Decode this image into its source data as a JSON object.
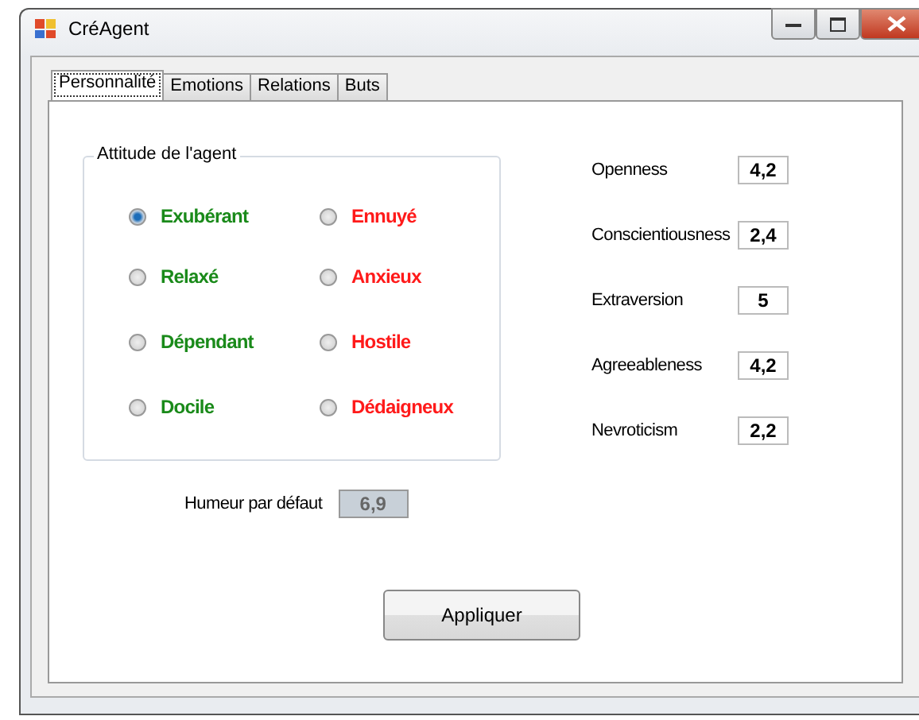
{
  "window": {
    "title": "CréAgent"
  },
  "tabs": [
    {
      "label": "Personnalité",
      "selected": true
    },
    {
      "label": "Emotions",
      "selected": false
    },
    {
      "label": "Relations",
      "selected": false
    },
    {
      "label": "Buts",
      "selected": false
    }
  ],
  "attitude_group": {
    "title": "Attitude de l'agent",
    "options": [
      {
        "label": "Exubérant",
        "selected": true,
        "color": "#1a8a1a"
      },
      {
        "label": "Ennuyé",
        "selected": false,
        "color": "#ff1a1a"
      },
      {
        "label": "Relaxé",
        "selected": false,
        "color": "#1a8a1a"
      },
      {
        "label": "Anxieux",
        "selected": false,
        "color": "#ff1a1a"
      },
      {
        "label": "Dépendant",
        "selected": false,
        "color": "#1a8a1a"
      },
      {
        "label": "Hostile",
        "selected": false,
        "color": "#ff1a1a"
      },
      {
        "label": "Docile",
        "selected": false,
        "color": "#1a8a1a"
      },
      {
        "label": "Dédaigneux",
        "selected": false,
        "color": "#ff1a1a"
      }
    ]
  },
  "default_mood": {
    "label": "Humeur par défaut",
    "value": "6,9",
    "disabled": true
  },
  "apply_button": "Appliquer",
  "traits": [
    {
      "label": "Openness",
      "value": "4,2"
    },
    {
      "label": "Conscientiousness",
      "value": "2,4"
    },
    {
      "label": "Extraversion",
      "value": "5"
    },
    {
      "label": "Agreeableness",
      "value": "4,2"
    },
    {
      "label": "Nevroticism",
      "value": "2,2"
    }
  ]
}
